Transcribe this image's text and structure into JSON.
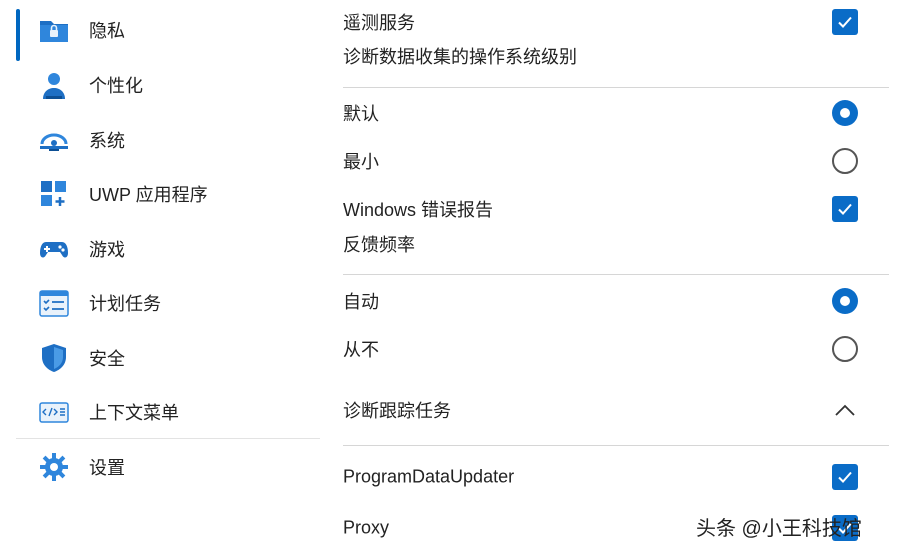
{
  "sidebar": {
    "items": [
      {
        "label": "隐私",
        "icon": "privacy-folder-icon",
        "active": true
      },
      {
        "label": "个性化",
        "icon": "person-icon"
      },
      {
        "label": "系统",
        "icon": "system-monitor-icon"
      },
      {
        "label": "UWP 应用程序",
        "icon": "apps-grid-icon"
      },
      {
        "label": "游戏",
        "icon": "gamepad-icon"
      },
      {
        "label": "计划任务",
        "icon": "task-list-icon"
      },
      {
        "label": "安全",
        "icon": "shield-icon"
      },
      {
        "label": "上下文菜单",
        "icon": "context-menu-code-icon"
      },
      {
        "label": "设置",
        "icon": "gear-icon"
      }
    ]
  },
  "main": {
    "telemetry": {
      "label": "遥测服务",
      "checked": true
    },
    "diag_heading": "诊断数据收集的操作系统级别",
    "diag_options": [
      {
        "label": "默认",
        "selected": true
      },
      {
        "label": "最小",
        "selected": false
      }
    ],
    "error_report": {
      "label": "Windows 错误报告",
      "checked": true
    },
    "feedback_heading": "反馈频率",
    "feedback_options": [
      {
        "label": "自动",
        "selected": true
      },
      {
        "label": "从不",
        "selected": false
      }
    ],
    "trace_section": {
      "label": "诊断跟踪任务",
      "expanded": true
    },
    "tasks": [
      {
        "label": "ProgramDataUpdater",
        "checked": true
      },
      {
        "label": "Proxy",
        "checked": true
      }
    ]
  },
  "watermark": "头条 @小王科技馆",
  "colors": {
    "accent": "#0a6cc7",
    "active_indicator": "#0067c0",
    "divider": "#d6d6d6"
  }
}
